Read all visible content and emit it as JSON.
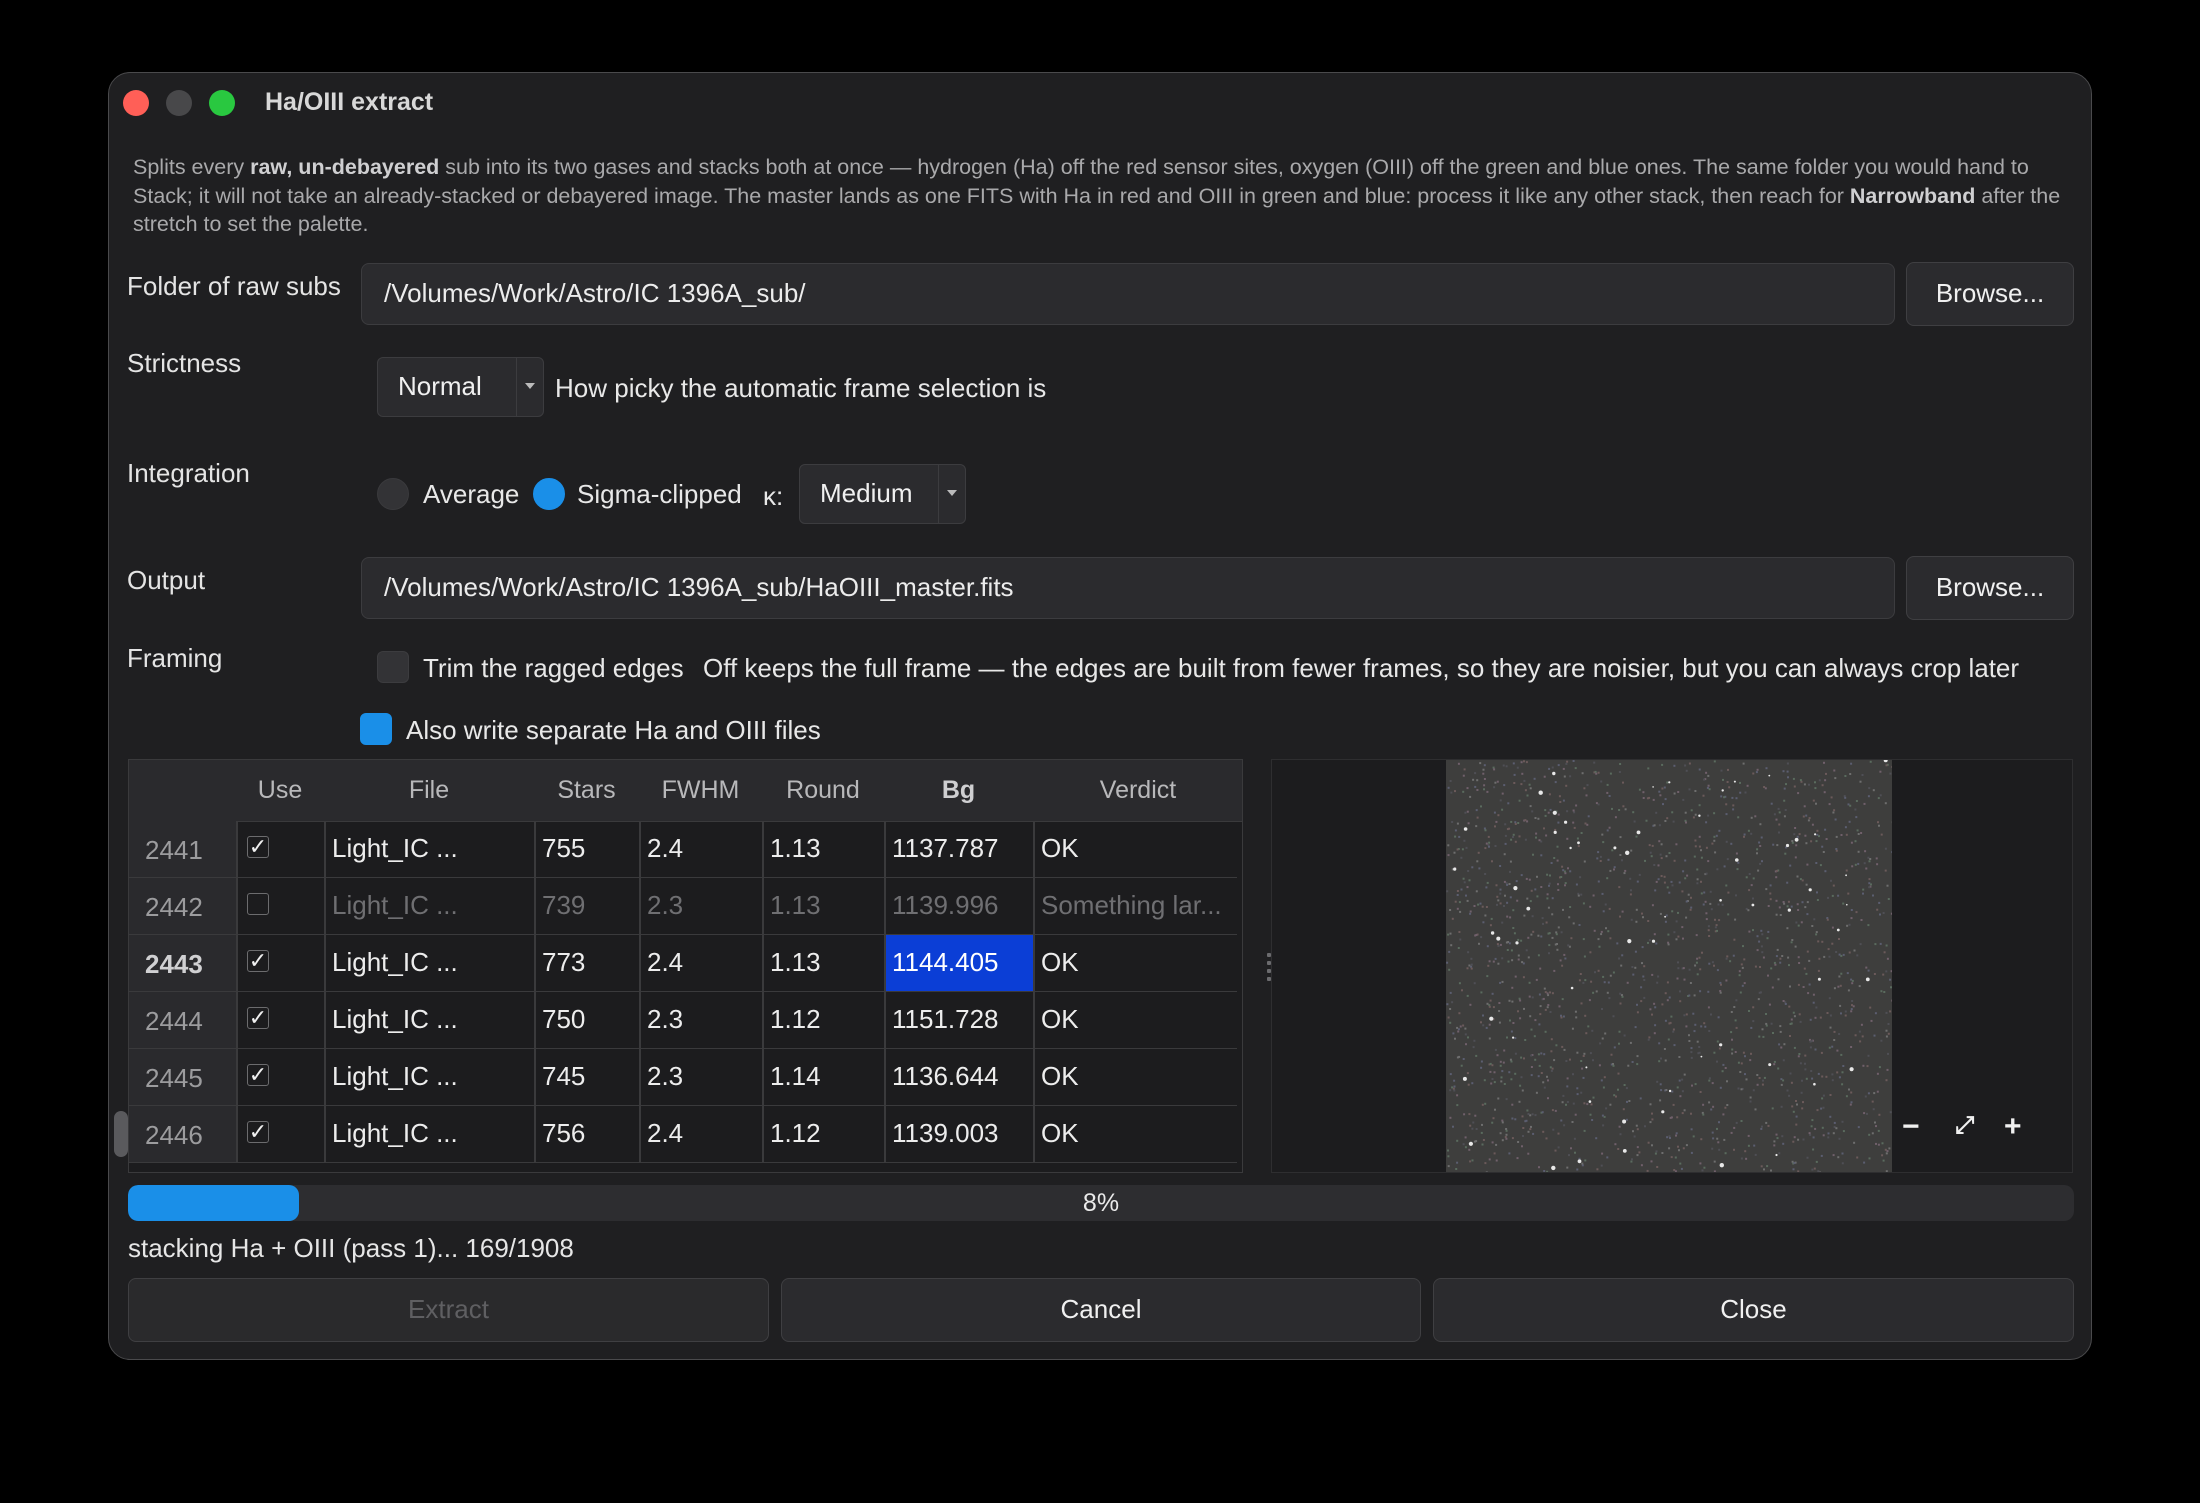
{
  "window": {
    "title": "Ha/OIII extract"
  },
  "description": {
    "p1": "Splits every ",
    "b1": "raw, un-debayered",
    "p2": " sub into its two gases and stacks both at once — hydrogen (Ha) off the red sensor sites, oxygen (OIII) off the green and blue ones. The same folder you would hand to Stack; it will not take an already-stacked or debayered image. The master lands as one FITS with Ha in red and OIII in green and blue: process it like any other stack, then reach for ",
    "b2": "Narrowband",
    "p3": " after the stretch to set the palette."
  },
  "folder": {
    "label": "Folder of raw subs",
    "value": "/Volumes/Work/Astro/IC 1396A_sub/",
    "browse": "Browse..."
  },
  "strictness": {
    "label": "Strictness",
    "value": "Normal",
    "hint": "How picky the automatic frame selection is"
  },
  "integration": {
    "label": "Integration",
    "average": "Average",
    "sigma": "Sigma-clipped",
    "kappa_label": "κ:",
    "kappa_value": "Medium",
    "selected": "sigma"
  },
  "output": {
    "label": "Output",
    "value": "/Volumes/Work/Astro/IC 1396A_sub/HaOIII_master.fits",
    "browse": "Browse..."
  },
  "framing": {
    "label": "Framing",
    "trim_label": "Trim the ragged edges",
    "trim_checked": false,
    "trim_hint": "Off keeps the full frame — the edges are built from fewer frames, so they are noisier, but you can always crop later",
    "separate_label": "Also write separate Ha and OIII files",
    "separate_checked": true
  },
  "table": {
    "headers": [
      "Use",
      "File",
      "Stars",
      "FWHM",
      "Round",
      "Bg",
      "Verdict"
    ],
    "rows": [
      {
        "num": "2441",
        "use": "✓",
        "file": "Light_IC ...",
        "stars": "755",
        "fwhm": "2.4",
        "round": "1.13",
        "bg": "1137.787",
        "verdict": "OK"
      },
      {
        "num": "2442",
        "use": "",
        "file": "Light_IC ...",
        "stars": "739",
        "fwhm": "2.3",
        "round": "1.13",
        "bg": "1139.996",
        "verdict": "Something lar..."
      },
      {
        "num": "2443",
        "use": "✓",
        "file": "Light_IC ...",
        "stars": "773",
        "fwhm": "2.4",
        "round": "1.13",
        "bg": "1144.405",
        "verdict": "OK"
      },
      {
        "num": "2444",
        "use": "✓",
        "file": "Light_IC ...",
        "stars": "750",
        "fwhm": "2.3",
        "round": "1.12",
        "bg": "1151.728",
        "verdict": "OK"
      },
      {
        "num": "2445",
        "use": "✓",
        "file": "Light_IC ...",
        "stars": "745",
        "fwhm": "2.3",
        "round": "1.14",
        "bg": "1136.644",
        "verdict": "OK"
      },
      {
        "num": "2446",
        "use": "✓",
        "file": "Light_IC ...",
        "stars": "756",
        "fwhm": "2.4",
        "round": "1.12",
        "bg": "1139.003",
        "verdict": "OK"
      }
    ]
  },
  "preview": {
    "zoom_out": "−",
    "fit": "⤢",
    "zoom_in": "+"
  },
  "progress": {
    "value": 0.08,
    "label": "8%"
  },
  "status": "stacking Ha + OIII (pass 1)... 169/1908",
  "buttons": {
    "extract": "Extract",
    "cancel": "Cancel",
    "close": "Close"
  },
  "colors": {
    "accent": "#1a8fe8",
    "selection": "#0b3ed6"
  },
  "icons": {
    "close": "close-icon",
    "minimize": "minimize-icon",
    "zoom": "zoom-icon",
    "dropdown": "chevron-down-icon"
  }
}
